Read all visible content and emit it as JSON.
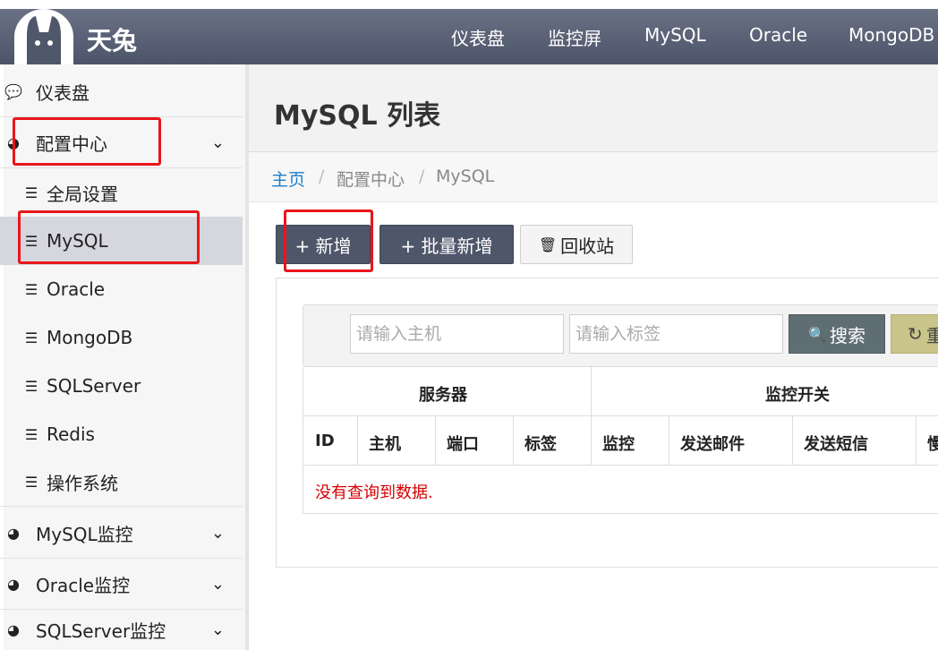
{
  "header": {
    "brand": "天兔",
    "nav": [
      "仪表盘",
      "监控屏",
      "MySQL",
      "Oracle",
      "MongoDB"
    ]
  },
  "sidebar": {
    "dashboard": "仪表盘",
    "config_center": "配置中心",
    "sub_items": [
      "全局设置",
      "MySQL",
      "Oracle",
      "MongoDB",
      "SQLServer",
      "Redis",
      "操作系统"
    ],
    "mysql_monitor": "MySQL监控",
    "oracle_monitor": "Oracle监控",
    "sqlserver_monitor": "SQLServer监控"
  },
  "page": {
    "title": "MySQL 列表",
    "breadcrumb": {
      "home": "主页",
      "sep": "/",
      "section": "配置中心",
      "current": "MySQL"
    }
  },
  "actions": {
    "add": "+ 新增",
    "batch_add": "+ 批量新增",
    "recycle": "回收站"
  },
  "filter": {
    "host_placeholder": "请输入主机",
    "tag_placeholder": "请输入标签",
    "search": "搜索",
    "reset": "重"
  },
  "table": {
    "group_server": "服务器",
    "group_monitor": "监控开关",
    "columns": [
      "ID",
      "主机",
      "端口",
      "标签",
      "监控",
      "发送邮件",
      "发送短信",
      "慢"
    ],
    "empty_text": "没有查询到数据."
  },
  "colors": {
    "navbar": "#545c70",
    "highlight": "#e8161b",
    "link": "#1e7ec8",
    "empty": "#d40000"
  }
}
